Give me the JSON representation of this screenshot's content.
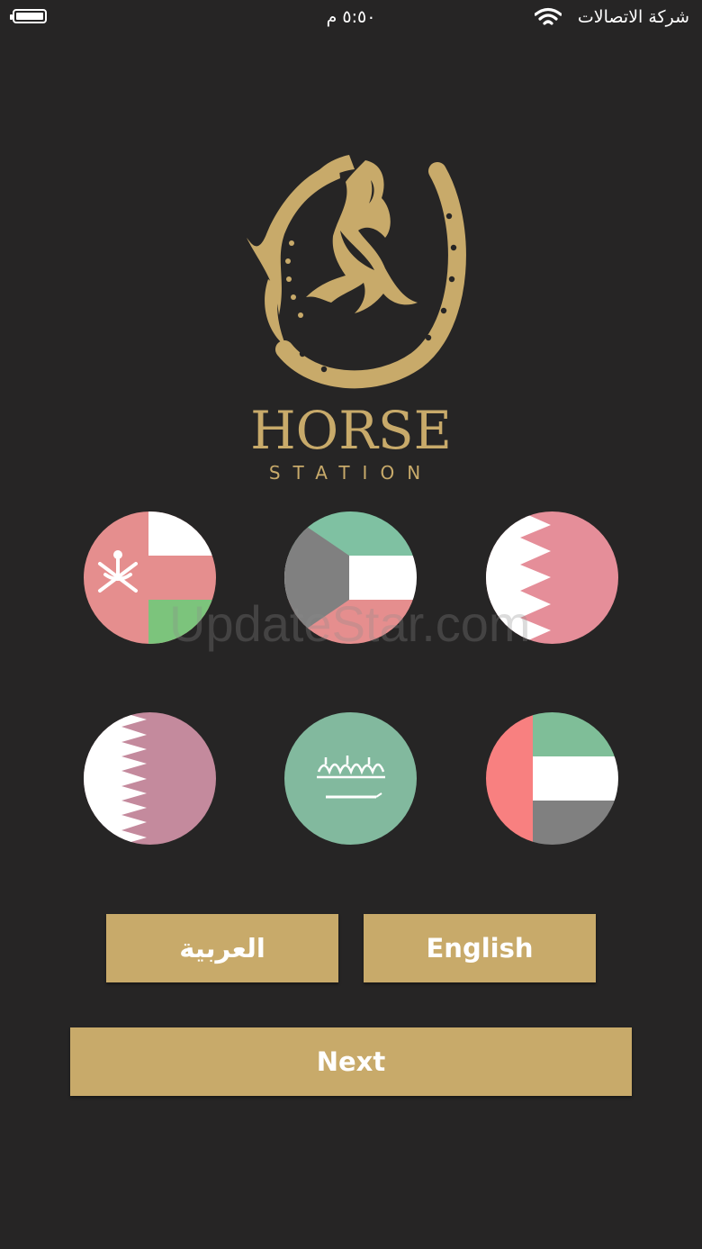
{
  "status_bar": {
    "time": "٥:٥٠ م",
    "carrier": "شركة الاتصالات"
  },
  "logo": {
    "title": "HORSE",
    "subtitle": "STATION",
    "color": "#c8aa6a"
  },
  "watermark": "UpdateStar.com",
  "flags": [
    {
      "country": "Oman",
      "icon": "oman-flag-icon"
    },
    {
      "country": "Kuwait",
      "icon": "kuwait-flag-icon"
    },
    {
      "country": "Bahrain",
      "icon": "bahrain-flag-icon"
    },
    {
      "country": "Qatar",
      "icon": "qatar-flag-icon"
    },
    {
      "country": "Saudi Arabia",
      "icon": "saudi-flag-icon"
    },
    {
      "country": "United Arab Emirates",
      "icon": "uae-flag-icon"
    }
  ],
  "language_buttons": {
    "arabic_label": "العربية",
    "english_label": "English"
  },
  "next_label": "Next",
  "colors": {
    "background": "#262525",
    "accent": "#c8aa6a"
  }
}
